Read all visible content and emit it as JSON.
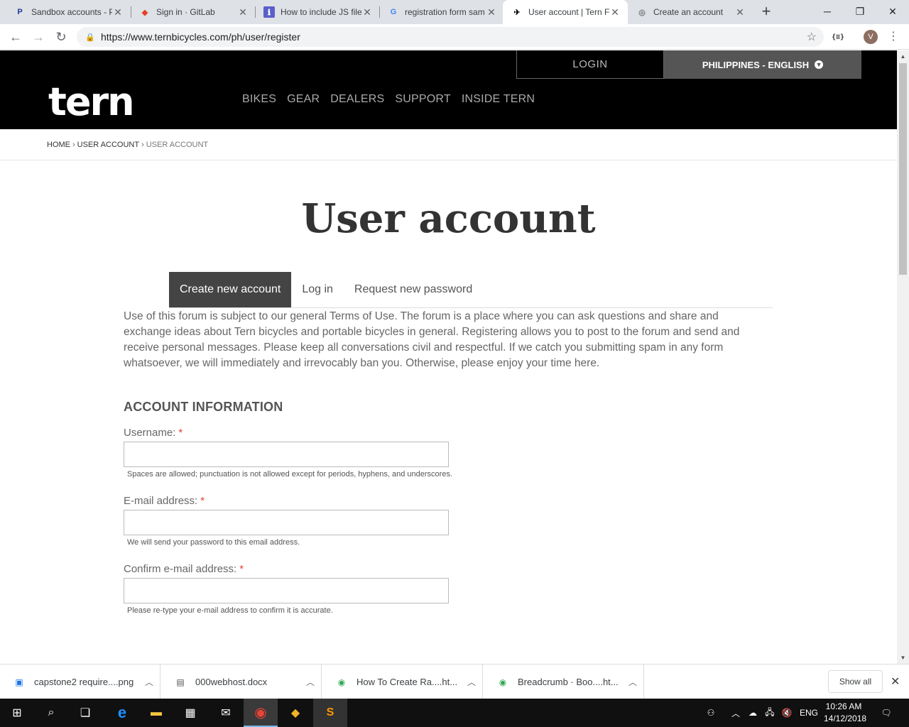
{
  "browser": {
    "tabs": [
      {
        "title": "Sandbox accounts - P",
        "favicon": "paypal-icon",
        "fav_char": "P",
        "fav_color": "#1f3a93"
      },
      {
        "title": "Sign in · GitLab",
        "favicon": "gitlab-icon",
        "fav_char": "◆",
        "fav_color": "#e24329"
      },
      {
        "title": "How to include JS file",
        "favicon": "stackexchange-icon",
        "fav_char": "ℹ",
        "fav_color": "#5a5fc8"
      },
      {
        "title": "registration form sam",
        "favicon": "google-icon",
        "fav_char": "G",
        "fav_color": "#4285f4"
      },
      {
        "title": "User account | Tern F",
        "favicon": "tern-bird-icon",
        "fav_char": "✈",
        "fav_color": "#000000"
      },
      {
        "title": "Create an account",
        "favicon": "globe-icon",
        "fav_char": "◎",
        "fav_color": "#777777"
      }
    ],
    "url": "https://www.ternbicycles.com/ph/user/register",
    "extension_label": "{≡}",
    "profile_initial": "V"
  },
  "site": {
    "login_label": "LOGIN",
    "language_label": "PHILIPPINES - ENGLISH",
    "logo_text": "tern",
    "nav": [
      "BIKES",
      "GEAR",
      "DEALERS",
      "SUPPORT",
      "INSIDE TERN"
    ],
    "breadcrumb": {
      "home": "HOME",
      "mid": "USER ACCOUNT",
      "current": "USER ACCOUNT"
    }
  },
  "page": {
    "title": "User account",
    "tabs": [
      "Create new account",
      "Log in",
      "Request new password"
    ],
    "intro": "Use of this forum is subject to our general Terms of Use. The forum is a place where you can ask questions and share and exchange ideas about Tern bicycles and portable bicycles in general. Registering allows you to post to the forum and send and receive personal messages. Please keep all conversations civil and respectful. If we catch you submitting spam in any form whatsoever, we will immediately and irrevocably ban you. Otherwise, please enjoy your time here.",
    "section_heading": "ACCOUNT INFORMATION",
    "fields": [
      {
        "label": "Username:",
        "required": "*",
        "value": "",
        "description": "Spaces are allowed; punctuation is not allowed except for periods, hyphens, and underscores."
      },
      {
        "label": "E-mail address:",
        "required": "*",
        "value": "",
        "description": "We will send your password to this email address."
      },
      {
        "label": "Confirm e-mail address:",
        "required": "*",
        "value": "",
        "description": "Please re-type your e-mail address to confirm it is accurate."
      }
    ]
  },
  "downloads": {
    "items": [
      {
        "name": "capstone2 require....png",
        "icon": "image-file-icon"
      },
      {
        "name": "000webhost.docx",
        "icon": "document-file-icon"
      },
      {
        "name": "How To Create Ra....ht...",
        "icon": "chrome-file-icon"
      },
      {
        "name": "Breadcrumb · Boo....ht...",
        "icon": "chrome-file-icon"
      }
    ],
    "show_all": "Show all"
  },
  "taskbar": {
    "language": "ENG",
    "time": "10:26 AM",
    "date": "14/12/2018"
  },
  "colors": {
    "site_header_bg": "#000000",
    "active_tab_bg": "#444444",
    "required_star": "#dd4433"
  }
}
